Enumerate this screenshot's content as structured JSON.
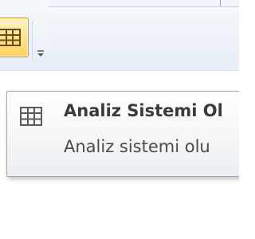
{
  "toolbar": {
    "table_button": {
      "icon": "table-icon",
      "state": "hover"
    },
    "customize_dropdown": {
      "icon": "customize-qat-dropdown-icon"
    }
  },
  "tooltip": {
    "icon": "table-icon",
    "title": "Analiz Sistemi Ol",
    "description": "Analiz sistemi olu"
  },
  "colors": {
    "hover_fill": "#ffe08a",
    "hover_border": "#c99a2b",
    "tooltip_border": "#a7a7a7",
    "text": "#3a3a3a"
  }
}
